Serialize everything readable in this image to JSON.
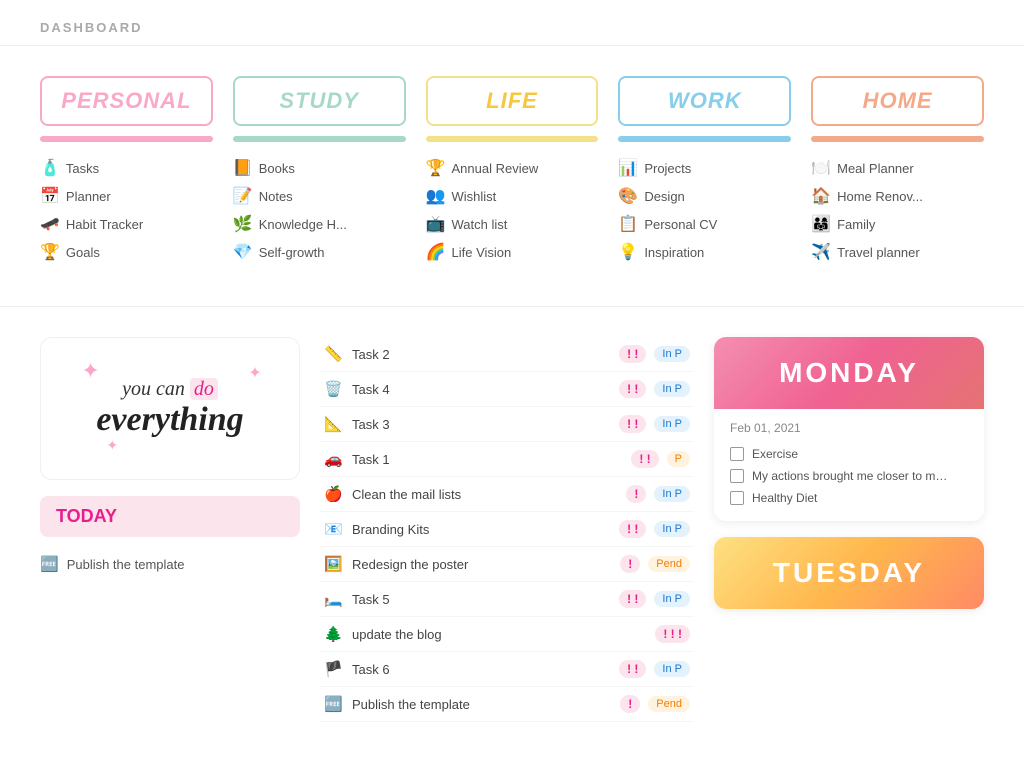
{
  "header": {
    "title": "DASHBOARD"
  },
  "categories": [
    {
      "id": "personal",
      "label": "PERSONAL",
      "items": [
        {
          "icon": "🧴",
          "label": "Tasks"
        },
        {
          "icon": "📅",
          "label": "Planner"
        },
        {
          "icon": "🛹",
          "label": "Habit Tracker"
        },
        {
          "icon": "🏆",
          "label": "Goals"
        }
      ]
    },
    {
      "id": "study",
      "label": "STUDY",
      "items": [
        {
          "icon": "📙",
          "label": "Books"
        },
        {
          "icon": "📝",
          "label": "Notes"
        },
        {
          "icon": "🌿",
          "label": "Knowledge H..."
        },
        {
          "icon": "💎",
          "label": "Self-growth"
        }
      ]
    },
    {
      "id": "life",
      "label": "LIFE",
      "items": [
        {
          "icon": "🏆",
          "label": "Annual Review"
        },
        {
          "icon": "👥",
          "label": "Wishlist"
        },
        {
          "icon": "📺",
          "label": "Watch list"
        },
        {
          "icon": "🌈",
          "label": "Life Vision"
        }
      ]
    },
    {
      "id": "work",
      "label": "WORK",
      "items": [
        {
          "icon": "📊",
          "label": "Projects"
        },
        {
          "icon": "🎨",
          "label": "Design"
        },
        {
          "icon": "📋",
          "label": "Personal CV"
        },
        {
          "icon": "💡",
          "label": "Inspiration"
        }
      ]
    },
    {
      "id": "home",
      "label": "HOME",
      "items": [
        {
          "icon": "🍽️",
          "label": "Meal Planner"
        },
        {
          "icon": "🏠",
          "label": "Home Renov..."
        },
        {
          "icon": "👨‍👩‍👧",
          "label": "Family"
        },
        {
          "icon": "✈️",
          "label": "Travel planner"
        }
      ]
    }
  ],
  "motivational": {
    "line1": "you can do",
    "line2": "everything"
  },
  "today": {
    "label": "TODAY",
    "tasks": [
      {
        "icon": "🆓",
        "label": "Publish the template"
      }
    ]
  },
  "task_list": [
    {
      "icon": "📏",
      "name": "Task 2",
      "tags": [
        "! !",
        "In P"
      ]
    },
    {
      "icon": "🗑️",
      "name": "Task 4",
      "tags": [
        "! !",
        "In P"
      ]
    },
    {
      "icon": "📐",
      "name": "Task 3",
      "tags": [
        "! !",
        "In P"
      ]
    },
    {
      "icon": "🚗",
      "name": "Task 1",
      "tags": [
        "! !",
        "P"
      ]
    },
    {
      "icon": "🍎",
      "name": "Clean the mail lists",
      "tags": [
        "!",
        "In P"
      ]
    },
    {
      "icon": "📧",
      "name": "Branding Kits",
      "tags": [
        "! !",
        "In P"
      ]
    },
    {
      "icon": "🖼️",
      "name": "Redesign the poster",
      "tags": [
        "!",
        "Pend"
      ]
    },
    {
      "icon": "🛏️",
      "name": "Task 5",
      "tags": [
        "! !",
        "In P"
      ]
    },
    {
      "icon": "🌲",
      "name": "update the blog",
      "tags": [
        "! ! !"
      ]
    },
    {
      "icon": "🏴",
      "name": "Task 6",
      "tags": [
        "! !",
        "In P"
      ]
    },
    {
      "icon": "🆓",
      "name": "Publish the template",
      "tags": [
        "!",
        "Pend"
      ]
    }
  ],
  "monday_card": {
    "day": "MONDAY",
    "date": "Feb 01, 2021",
    "items": [
      "Exercise",
      "My actions brought me closer to my long-term go...",
      "Healthy Diet"
    ]
  },
  "tuesday_card": {
    "day": "TUESDAY"
  }
}
